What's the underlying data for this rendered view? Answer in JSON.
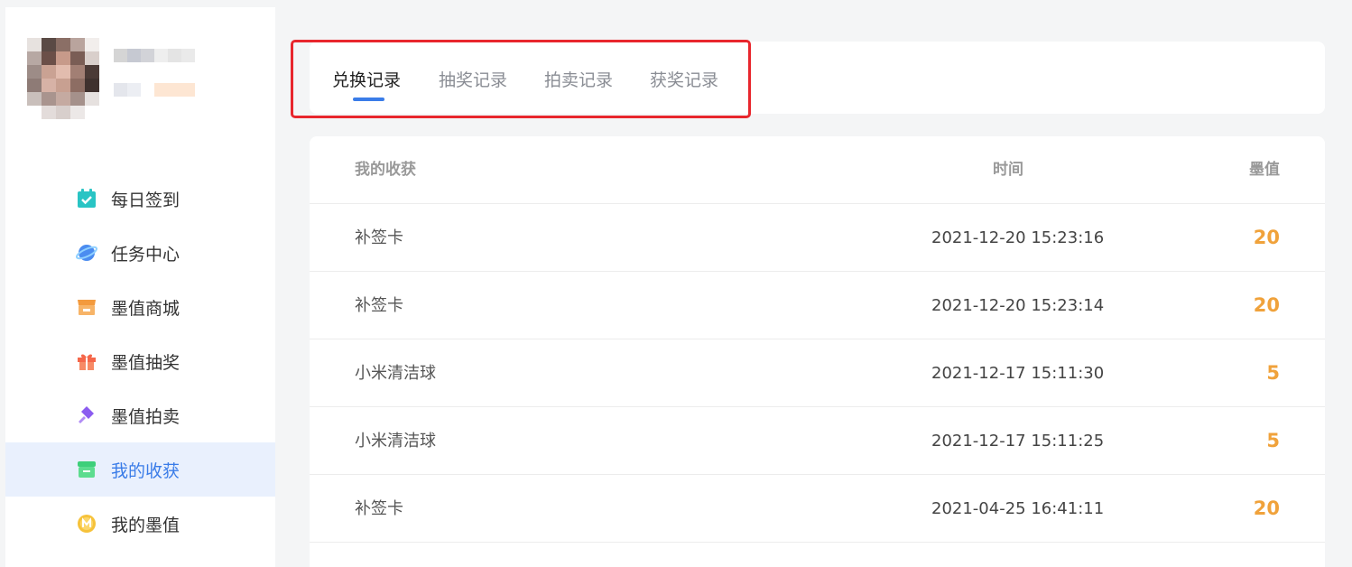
{
  "sidebar": {
    "items": [
      {
        "label": "每日签到",
        "icon": "calendar-check-icon",
        "color": "#29c4c4"
      },
      {
        "label": "任务中心",
        "icon": "planet-icon",
        "color": "#4b8cf0"
      },
      {
        "label": "墨值商城",
        "icon": "shop-icon",
        "color": "#f39a3d"
      },
      {
        "label": "墨值抽奖",
        "icon": "gift-icon",
        "color": "#f5674a"
      },
      {
        "label": "墨值拍卖",
        "icon": "gavel-icon",
        "color": "#8b5cf0"
      },
      {
        "label": "我的收获",
        "icon": "archive-box-icon",
        "color": "#3ecf7a",
        "active": true
      },
      {
        "label": "我的墨值",
        "icon": "coin-icon",
        "color": "#f6c23a"
      }
    ]
  },
  "tabs": [
    {
      "label": "兑换记录",
      "active": true
    },
    {
      "label": "抽奖记录"
    },
    {
      "label": "拍卖记录"
    },
    {
      "label": "获奖记录"
    }
  ],
  "table": {
    "headers": {
      "name": "我的收获",
      "time": "时间",
      "value": "墨值"
    },
    "rows": [
      {
        "name": "补签卡",
        "time": "2021-12-20 15:23:16",
        "value": "20"
      },
      {
        "name": "补签卡",
        "time": "2021-12-20 15:23:14",
        "value": "20"
      },
      {
        "name": "小米清洁球",
        "time": "2021-12-17 15:11:30",
        "value": "5"
      },
      {
        "name": "小米清洁球",
        "time": "2021-12-17 15:11:25",
        "value": "5"
      },
      {
        "name": "补签卡",
        "time": "2021-04-25 16:41:11",
        "value": "20"
      }
    ]
  },
  "colors": {
    "accent": "#3a7ce8",
    "value": "#f0a23b",
    "highlight": "#e8262d"
  }
}
